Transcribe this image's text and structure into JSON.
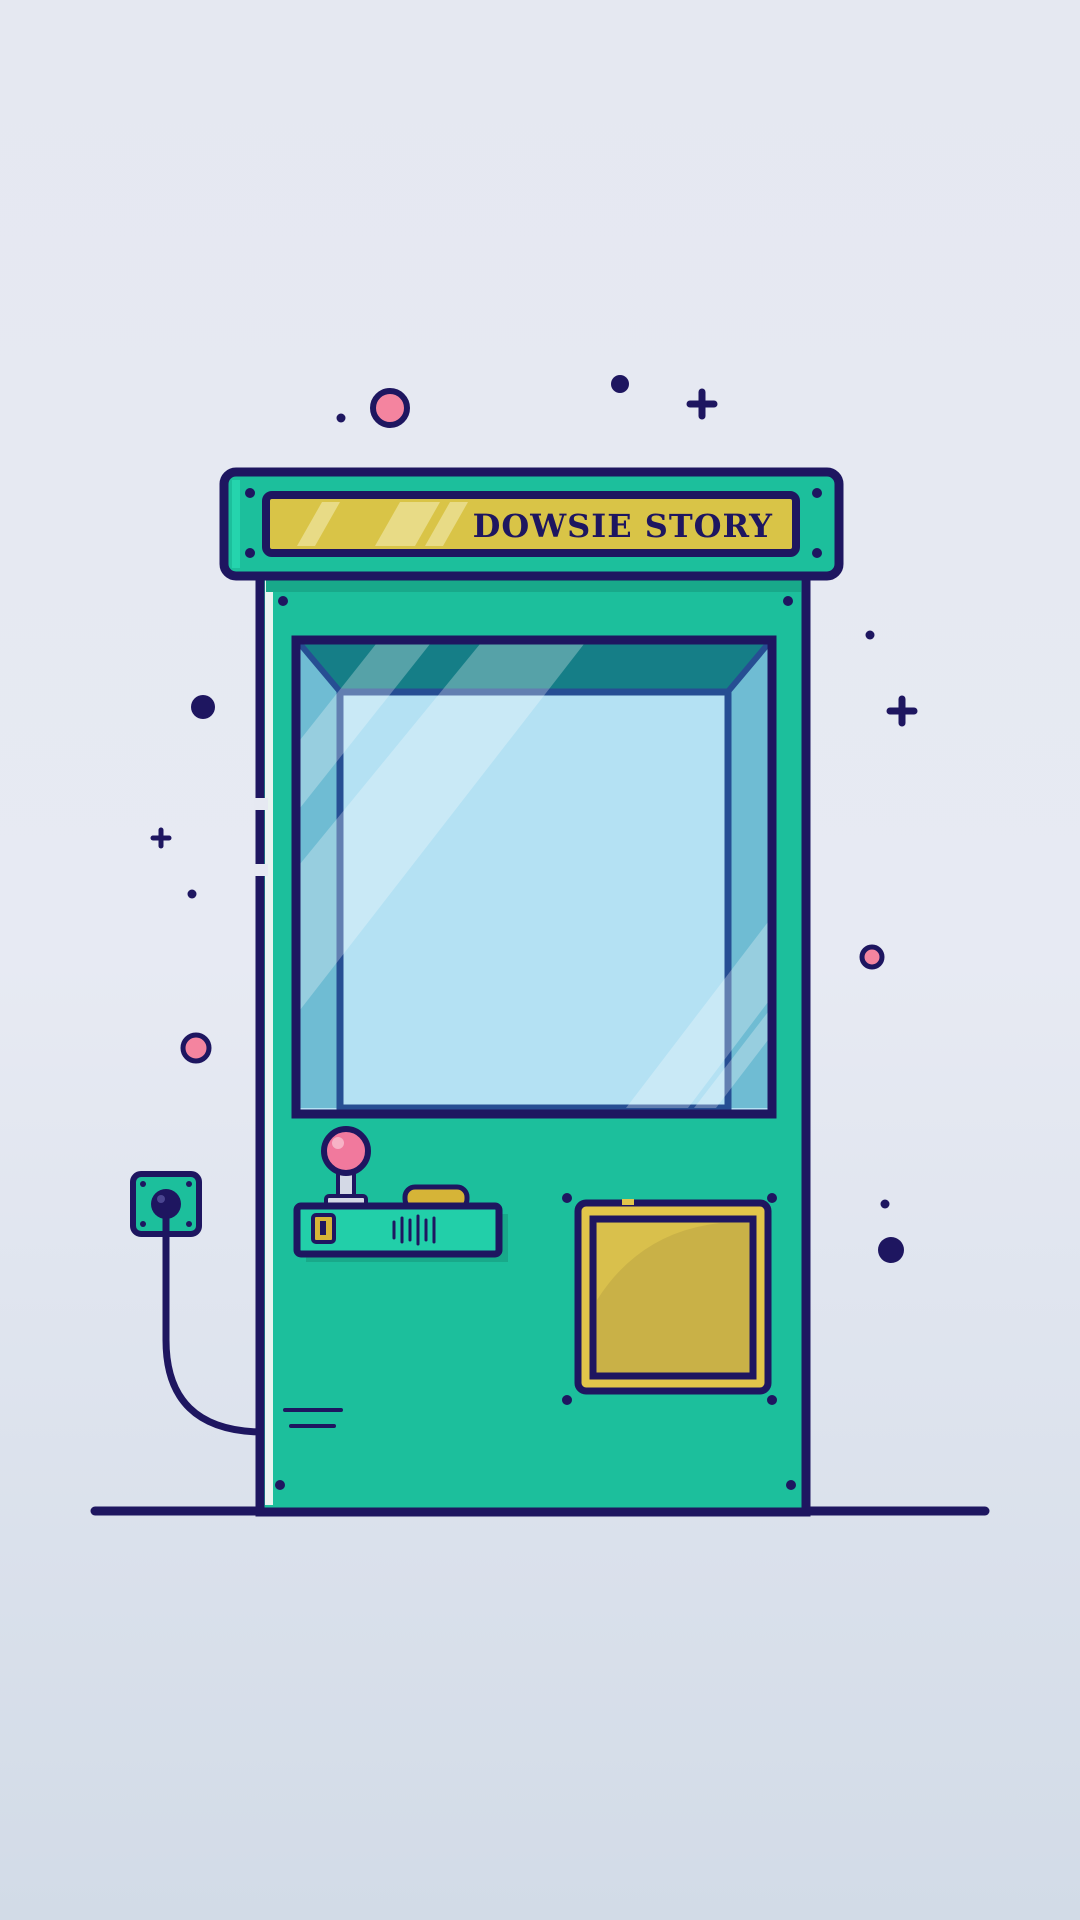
{
  "illustration": {
    "subject": "claw-machine",
    "marquee_text": "DOWSIE STORY",
    "colors": {
      "background_top": "#e5e8f1",
      "background_bottom": "#d2dbe7",
      "outline": "#1e1660",
      "cabinet": "#1cbf9c",
      "cabinet_light": "#22cfa9",
      "marquee_sign": "#d9c447",
      "glass": "#b4e1f3",
      "glass_side": "#6fbcd3",
      "glass_top": "#157e87",
      "joystick_ball": "#f1799d",
      "prize_door": "#c9b147",
      "decoration_pink": "#f4849f"
    }
  }
}
